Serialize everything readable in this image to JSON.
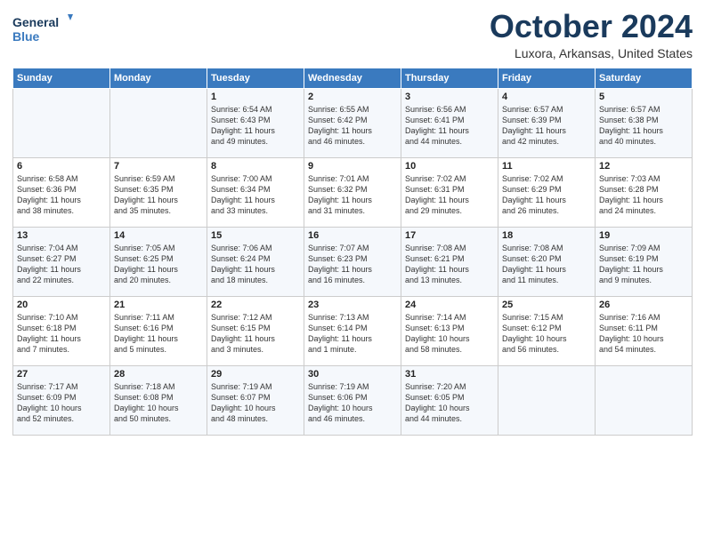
{
  "logo": {
    "line1": "General",
    "line2": "Blue"
  },
  "title": "October 2024",
  "location": "Luxora, Arkansas, United States",
  "headers": [
    "Sunday",
    "Monday",
    "Tuesday",
    "Wednesday",
    "Thursday",
    "Friday",
    "Saturday"
  ],
  "weeks": [
    [
      {
        "day": "",
        "info": ""
      },
      {
        "day": "",
        "info": ""
      },
      {
        "day": "1",
        "info": "Sunrise: 6:54 AM\nSunset: 6:43 PM\nDaylight: 11 hours\nand 49 minutes."
      },
      {
        "day": "2",
        "info": "Sunrise: 6:55 AM\nSunset: 6:42 PM\nDaylight: 11 hours\nand 46 minutes."
      },
      {
        "day": "3",
        "info": "Sunrise: 6:56 AM\nSunset: 6:41 PM\nDaylight: 11 hours\nand 44 minutes."
      },
      {
        "day": "4",
        "info": "Sunrise: 6:57 AM\nSunset: 6:39 PM\nDaylight: 11 hours\nand 42 minutes."
      },
      {
        "day": "5",
        "info": "Sunrise: 6:57 AM\nSunset: 6:38 PM\nDaylight: 11 hours\nand 40 minutes."
      }
    ],
    [
      {
        "day": "6",
        "info": "Sunrise: 6:58 AM\nSunset: 6:36 PM\nDaylight: 11 hours\nand 38 minutes."
      },
      {
        "day": "7",
        "info": "Sunrise: 6:59 AM\nSunset: 6:35 PM\nDaylight: 11 hours\nand 35 minutes."
      },
      {
        "day": "8",
        "info": "Sunrise: 7:00 AM\nSunset: 6:34 PM\nDaylight: 11 hours\nand 33 minutes."
      },
      {
        "day": "9",
        "info": "Sunrise: 7:01 AM\nSunset: 6:32 PM\nDaylight: 11 hours\nand 31 minutes."
      },
      {
        "day": "10",
        "info": "Sunrise: 7:02 AM\nSunset: 6:31 PM\nDaylight: 11 hours\nand 29 minutes."
      },
      {
        "day": "11",
        "info": "Sunrise: 7:02 AM\nSunset: 6:29 PM\nDaylight: 11 hours\nand 26 minutes."
      },
      {
        "day": "12",
        "info": "Sunrise: 7:03 AM\nSunset: 6:28 PM\nDaylight: 11 hours\nand 24 minutes."
      }
    ],
    [
      {
        "day": "13",
        "info": "Sunrise: 7:04 AM\nSunset: 6:27 PM\nDaylight: 11 hours\nand 22 minutes."
      },
      {
        "day": "14",
        "info": "Sunrise: 7:05 AM\nSunset: 6:25 PM\nDaylight: 11 hours\nand 20 minutes."
      },
      {
        "day": "15",
        "info": "Sunrise: 7:06 AM\nSunset: 6:24 PM\nDaylight: 11 hours\nand 18 minutes."
      },
      {
        "day": "16",
        "info": "Sunrise: 7:07 AM\nSunset: 6:23 PM\nDaylight: 11 hours\nand 16 minutes."
      },
      {
        "day": "17",
        "info": "Sunrise: 7:08 AM\nSunset: 6:21 PM\nDaylight: 11 hours\nand 13 minutes."
      },
      {
        "day": "18",
        "info": "Sunrise: 7:08 AM\nSunset: 6:20 PM\nDaylight: 11 hours\nand 11 minutes."
      },
      {
        "day": "19",
        "info": "Sunrise: 7:09 AM\nSunset: 6:19 PM\nDaylight: 11 hours\nand 9 minutes."
      }
    ],
    [
      {
        "day": "20",
        "info": "Sunrise: 7:10 AM\nSunset: 6:18 PM\nDaylight: 11 hours\nand 7 minutes."
      },
      {
        "day": "21",
        "info": "Sunrise: 7:11 AM\nSunset: 6:16 PM\nDaylight: 11 hours\nand 5 minutes."
      },
      {
        "day": "22",
        "info": "Sunrise: 7:12 AM\nSunset: 6:15 PM\nDaylight: 11 hours\nand 3 minutes."
      },
      {
        "day": "23",
        "info": "Sunrise: 7:13 AM\nSunset: 6:14 PM\nDaylight: 11 hours\nand 1 minute."
      },
      {
        "day": "24",
        "info": "Sunrise: 7:14 AM\nSunset: 6:13 PM\nDaylight: 10 hours\nand 58 minutes."
      },
      {
        "day": "25",
        "info": "Sunrise: 7:15 AM\nSunset: 6:12 PM\nDaylight: 10 hours\nand 56 minutes."
      },
      {
        "day": "26",
        "info": "Sunrise: 7:16 AM\nSunset: 6:11 PM\nDaylight: 10 hours\nand 54 minutes."
      }
    ],
    [
      {
        "day": "27",
        "info": "Sunrise: 7:17 AM\nSunset: 6:09 PM\nDaylight: 10 hours\nand 52 minutes."
      },
      {
        "day": "28",
        "info": "Sunrise: 7:18 AM\nSunset: 6:08 PM\nDaylight: 10 hours\nand 50 minutes."
      },
      {
        "day": "29",
        "info": "Sunrise: 7:19 AM\nSunset: 6:07 PM\nDaylight: 10 hours\nand 48 minutes."
      },
      {
        "day": "30",
        "info": "Sunrise: 7:19 AM\nSunset: 6:06 PM\nDaylight: 10 hours\nand 46 minutes."
      },
      {
        "day": "31",
        "info": "Sunrise: 7:20 AM\nSunset: 6:05 PM\nDaylight: 10 hours\nand 44 minutes."
      },
      {
        "day": "",
        "info": ""
      },
      {
        "day": "",
        "info": ""
      }
    ]
  ]
}
